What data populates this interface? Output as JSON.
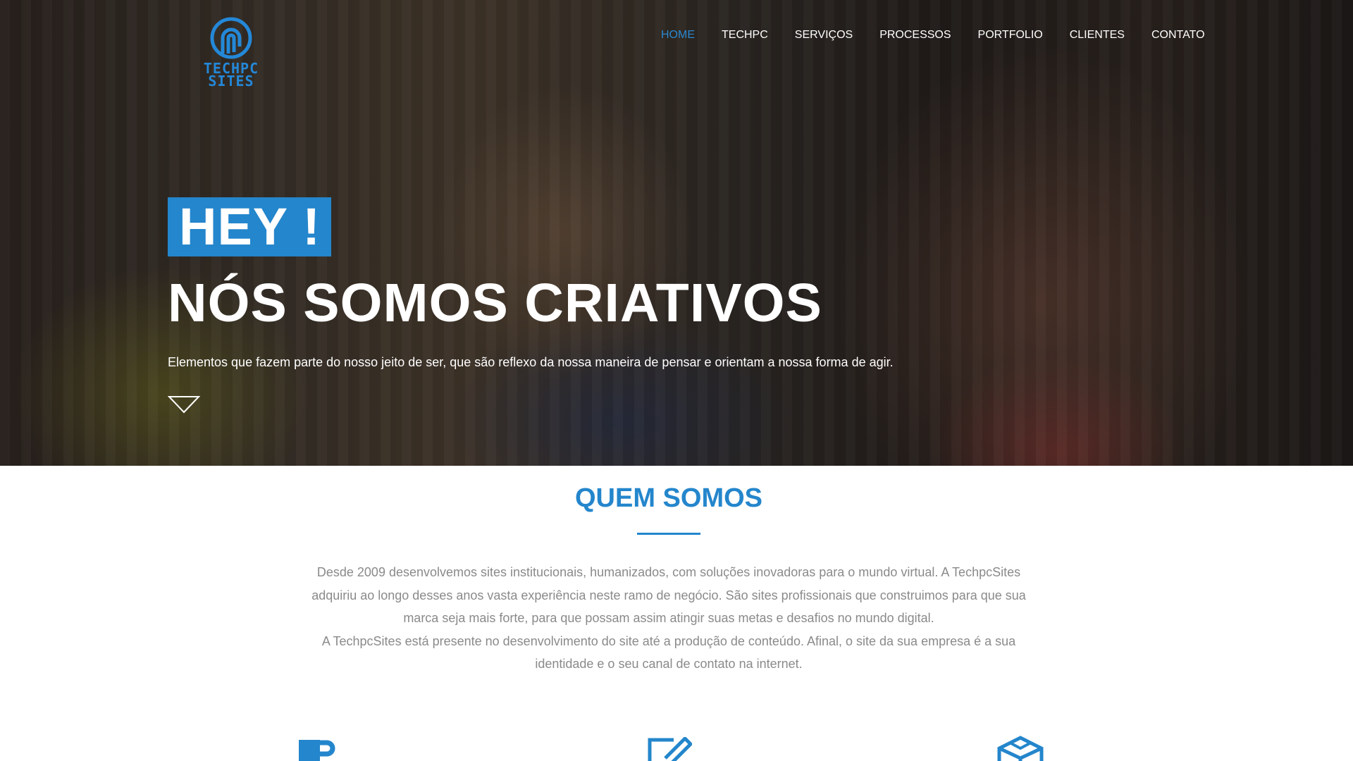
{
  "brand": {
    "logo_line1": "TECHPC",
    "logo_line2": "SITES",
    "accent_color": "#2486cc"
  },
  "nav": {
    "items": [
      {
        "label": "HOME",
        "active": true
      },
      {
        "label": "TECHPC"
      },
      {
        "label": "SERVIÇOS"
      },
      {
        "label": "PROCESSOS"
      },
      {
        "label": "PORTFOLIO"
      },
      {
        "label": "CLIENTES"
      },
      {
        "label": "CONTATO"
      }
    ]
  },
  "hero": {
    "badge": "HEY !",
    "title": "NÓS SOMOS CRIATIVOS",
    "subtitle": "Elementos que fazem parte do nosso jeito de ser, que são reflexo da nossa maneira de pensar e orientam a nossa forma de agir.",
    "scroll_icon": "chevron-down-outline-icon"
  },
  "about": {
    "title": "QUEM SOMOS",
    "paragraph1": "Desde 2009 desenvolvemos sites institucionais, humanizados, com soluções inovadoras para o mundo virtual. A TechpcSites adquiriu ao longo desses anos vasta experiência neste ramo de negócio. São sites profissionais que construimos para que sua marca seja mais forte, para que possam assim atingir suas metas e desafios no mundo digital.",
    "paragraph2": "A TechpcSites está presente no desenvolvimento do site até a produção de conteúdo. Afinal, o site da sua empresa é a sua identidade e o seu canal de contato na internet."
  },
  "features": {
    "icons": [
      "coffee-mug-icon",
      "edit-pencil-icon",
      "cube-icon"
    ]
  }
}
